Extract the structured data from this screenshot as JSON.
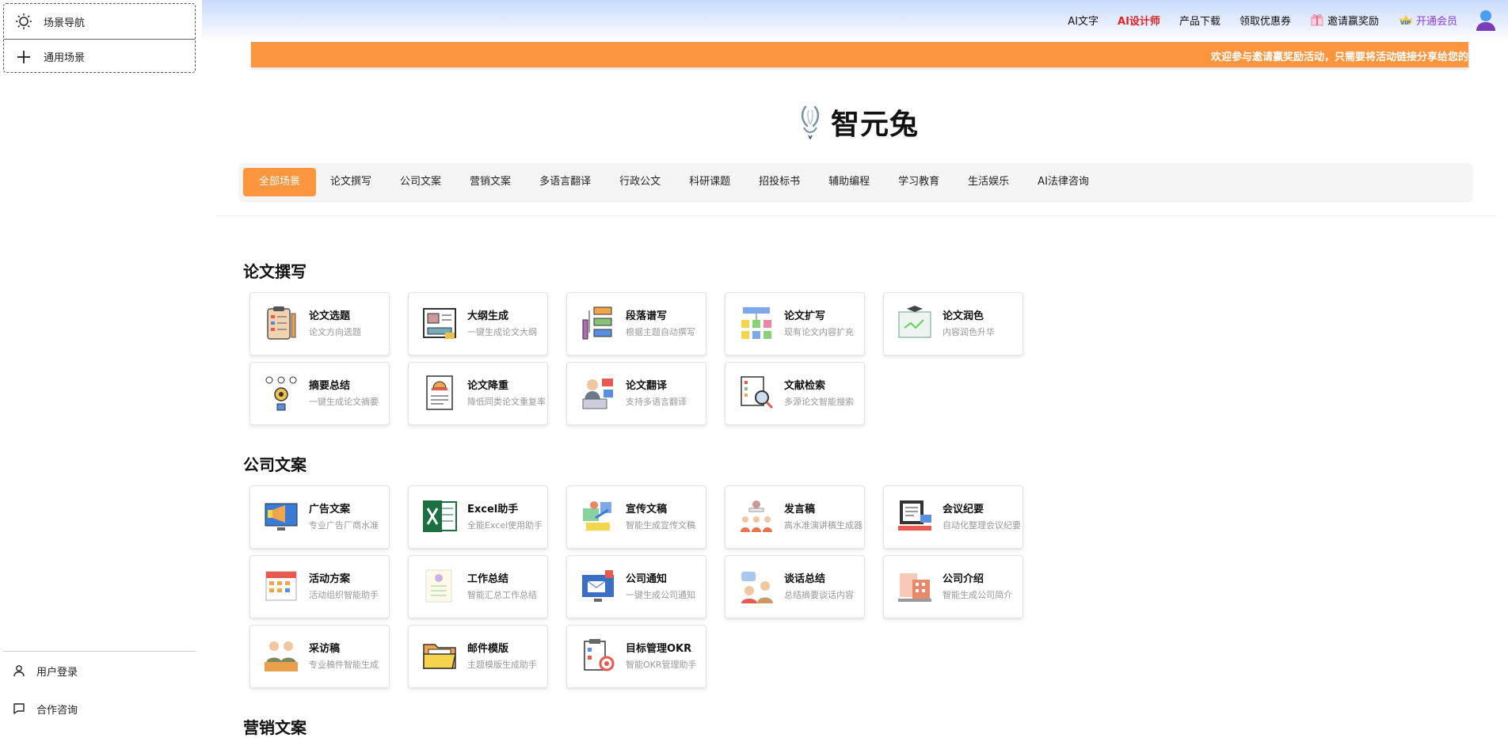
{
  "sidebar": {
    "menu": [
      {
        "label": "场景导航",
        "icon": "sun-icon"
      },
      {
        "label": "通用场景",
        "icon": "plus-icon"
      }
    ],
    "bottom": [
      {
        "label": "用户登录",
        "icon": "user-icon"
      },
      {
        "label": "合作咨询",
        "icon": "chat-icon"
      }
    ]
  },
  "topnav": {
    "ai_text": "AI文字",
    "ai_designer": "AI设计师",
    "download": "产品下载",
    "coupon": "领取优惠券",
    "invite": "邀请赢奖励",
    "vip": "开通会员"
  },
  "banner": {
    "text": "欢迎参与邀请赢奖励活动，只需要将活动链接分享给您的"
  },
  "logo": {
    "title": "智元兔"
  },
  "categories": [
    "全部场景",
    "论文撰写",
    "公司文案",
    "营销文案",
    "多语言翻译",
    "行政公文",
    "科研课题",
    "招投标书",
    "辅助编程",
    "学习教育",
    "生活娱乐",
    "AI法律咨询"
  ],
  "sections": [
    {
      "title": "论文撰写",
      "cards": [
        {
          "name": "论文选题",
          "desc": "论文方向选题",
          "icon": "clipboard-checklist-icon"
        },
        {
          "name": "大纲生成",
          "desc": "一键生成论文大纲",
          "icon": "outline-board-icon"
        },
        {
          "name": "段落谱写",
          "desc": "根据主题自动撰写",
          "icon": "flowchart-pen-icon"
        },
        {
          "name": "论文扩写",
          "desc": "现有论文内容扩充",
          "icon": "notes-tree-icon"
        },
        {
          "name": "论文润色",
          "desc": "内容润色升华",
          "icon": "graduation-board-icon"
        },
        {
          "name": "摘要总结",
          "desc": "一键生成论文摘要",
          "icon": "gear-network-icon"
        },
        {
          "name": "论文降重",
          "desc": "降低同类论文重复率",
          "icon": "document-helmet-icon"
        },
        {
          "name": "论文翻译",
          "desc": "支持多语言翻译",
          "icon": "translator-laptop-icon"
        },
        {
          "name": "文献检索",
          "desc": "多源论文智能搜索",
          "icon": "document-search-icon"
        }
      ]
    },
    {
      "title": "公司文案",
      "cards": [
        {
          "name": "广告文案",
          "desc": "专业广告厂商水准",
          "icon": "megaphone-monitor-icon"
        },
        {
          "name": "Excel助手",
          "desc": "全能Excel使用助手",
          "icon": "excel-icon"
        },
        {
          "name": "宣传文稿",
          "desc": "智能生成宣传文稿",
          "icon": "promo-board-icon"
        },
        {
          "name": "发言稿",
          "desc": "高水准演讲稿生成器",
          "icon": "speaker-audience-icon"
        },
        {
          "name": "会议纪要",
          "desc": "自动化整理会议纪要",
          "icon": "meeting-notes-icon"
        },
        {
          "name": "活动方案",
          "desc": "活动组织智能助手",
          "icon": "calendar-icon"
        },
        {
          "name": "工作总结",
          "desc": "智能汇总工作总结",
          "icon": "checklist-doc-icon"
        },
        {
          "name": "公司通知",
          "desc": "一键生成公司通知",
          "icon": "mail-monitor-icon"
        },
        {
          "name": "谈话总结",
          "desc": "总结摘要谈话内容",
          "icon": "conversation-icon"
        },
        {
          "name": "公司介绍",
          "desc": "智能生成公司简介",
          "icon": "company-building-icon"
        },
        {
          "name": "采访稿",
          "desc": "专业稿件智能生成",
          "icon": "interview-icon"
        },
        {
          "name": "邮件模版",
          "desc": "主题模版生成助手",
          "icon": "folder-icon"
        },
        {
          "name": "目标管理OKR",
          "desc": "智能OKR管理助手",
          "icon": "target-clipboard-icon"
        }
      ]
    },
    {
      "title": "营销文案",
      "cards": []
    }
  ]
}
